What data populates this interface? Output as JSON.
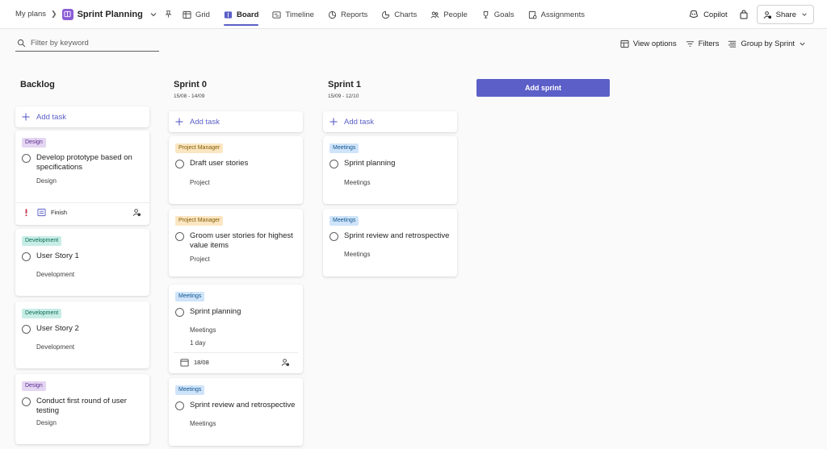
{
  "nav": {
    "breadcrumb_root": "My plans",
    "plan_title": "Sprint Planning",
    "views": [
      "Grid",
      "Board",
      "Timeline",
      "Reports",
      "Charts",
      "People",
      "Goals",
      "Assignments"
    ],
    "active_view": "Board",
    "copilot": "Copilot",
    "share": "Share"
  },
  "toolbar": {
    "filter_placeholder": "Filter by keyword",
    "view_options": "View options",
    "filters": "Filters",
    "group_by": "Group by Sprint"
  },
  "colors": {
    "accent": "#5b5fc7",
    "plan_icon": "#8a5cd6",
    "priority": "#c4314b"
  },
  "add_task_label": "Add task",
  "add_sprint_label": "Add sprint",
  "columns": [
    {
      "title": "Backlog",
      "dates": "",
      "cards": [
        {
          "label": "Design",
          "title": "Develop prototype based on specifications",
          "bucket": "Design",
          "priority_icon": "exclamation-icon",
          "footer_text": "Finish"
        },
        {
          "label": "Development",
          "title": "User Story 1",
          "bucket": "Development"
        },
        {
          "label": "Development",
          "title": "User Story 2",
          "bucket": "Development"
        },
        {
          "label": "Design",
          "title": "Conduct first round of user testing",
          "bucket": "Design"
        }
      ]
    },
    {
      "title": "Sprint 0",
      "dates": "15/08 - 14/09",
      "cards": [
        {
          "label": "Project Manager",
          "title": "Draft user stories",
          "bucket": "Project"
        },
        {
          "label": "Project Manager",
          "title": "Groom user stories for highest value items",
          "bucket": "Project"
        },
        {
          "label": "Meetings",
          "title": "Sprint planning",
          "bucket": "Meetings",
          "duration": "1 day",
          "due": "18/08"
        },
        {
          "label": "Meetings",
          "title": "Sprint review and retrospective",
          "bucket": "Meetings"
        }
      ]
    },
    {
      "title": "Sprint 1",
      "dates": "15/09 - 12/10",
      "cards": [
        {
          "label": "Meetings",
          "title": "Sprint planning",
          "bucket": "Meetings"
        },
        {
          "label": "Meetings",
          "title": "Sprint review and retrospective",
          "bucket": "Meetings"
        }
      ]
    }
  ]
}
